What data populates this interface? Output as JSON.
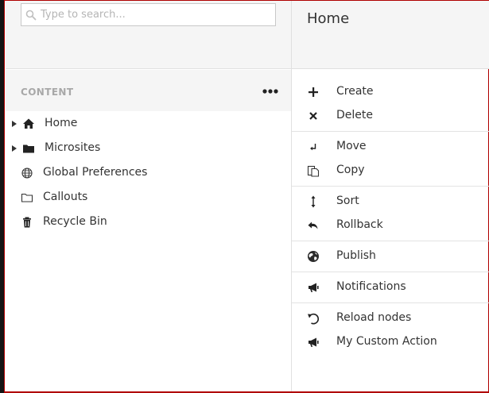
{
  "search": {
    "placeholder": "Type to search..."
  },
  "content_panel": {
    "title": "CONTENT",
    "more_icon": "ellipsis-icon",
    "tree": [
      {
        "label": "Home",
        "icon": "house-icon",
        "expandable": true
      },
      {
        "label": "Microsites",
        "icon": "folder-icon",
        "expandable": true
      },
      {
        "label": "Global Preferences",
        "icon": "globe-icon",
        "expandable": false
      },
      {
        "label": "Callouts",
        "icon": "folder-outline-icon",
        "expandable": false
      },
      {
        "label": "Recycle Bin",
        "icon": "trash-icon",
        "expandable": false
      }
    ]
  },
  "actions_panel": {
    "title": "Home",
    "actions": [
      {
        "label": "Create",
        "icon": "plus-icon"
      },
      {
        "label": "Delete",
        "icon": "close-icon"
      },
      {
        "label": "Move",
        "icon": "move-arrow-icon"
      },
      {
        "label": "Copy",
        "icon": "copy-icon"
      },
      {
        "label": "Sort",
        "icon": "sort-arrows-icon"
      },
      {
        "label": "Rollback",
        "icon": "undo-icon"
      },
      {
        "label": "Publish",
        "icon": "globe-icon"
      },
      {
        "label": "Notifications",
        "icon": "megaphone-icon"
      },
      {
        "label": "Reload nodes",
        "icon": "reload-icon"
      },
      {
        "label": "My Custom Action",
        "icon": "megaphone-icon"
      }
    ]
  },
  "colors": {
    "panel_header_bg": "#f5f5f5",
    "muted_text": "#a8a8a8",
    "text": "#333333",
    "frame_red": "#b00000"
  }
}
